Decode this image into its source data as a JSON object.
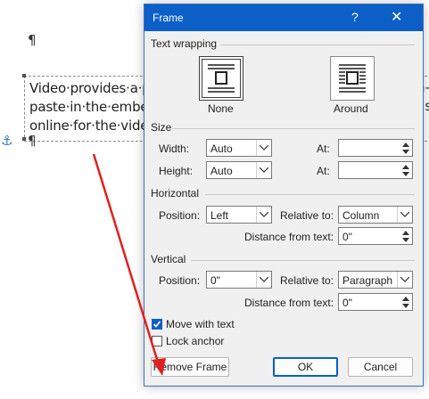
{
  "document": {
    "pilcrow": "¶",
    "anchor_icon": "anchor-icon",
    "lines": [
      "Video·provides·a·po",
      "paste·in·the·embed",
      "online·for·the·video"
    ],
    "right_fragments": [
      "n-",
      "als"
    ]
  },
  "dialog": {
    "title": "Frame",
    "help_glyph": "?",
    "close_glyph": "✕",
    "text_wrapping": {
      "heading": "Text wrapping",
      "options": [
        {
          "label": "None",
          "selected": true
        },
        {
          "label": "Around",
          "selected": false
        }
      ]
    },
    "size": {
      "heading": "Size",
      "width_label": "Width:",
      "width_value": "Auto",
      "height_label": "Height:",
      "height_value": "Auto",
      "at_label": "At:",
      "width_at_value": "",
      "height_at_value": ""
    },
    "horizontal": {
      "heading": "Horizontal",
      "position_label": "Position:",
      "position_value": "Left",
      "relative_label": "Relative to:",
      "relative_value": "Column",
      "distance_label": "Distance from text:",
      "distance_value": "0\""
    },
    "vertical": {
      "heading": "Vertical",
      "position_label": "Position:",
      "position_value": "0\"",
      "relative_label": "Relative to:",
      "relative_value": "Paragraph",
      "distance_label": "Distance from text:",
      "distance_value": "0\""
    },
    "move_with_text": {
      "label": "Move with text",
      "checked": true
    },
    "lock_anchor": {
      "label": "Lock anchor",
      "checked": false
    },
    "buttons": {
      "remove": "Remove Frame",
      "ok": "OK",
      "cancel": "Cancel"
    }
  },
  "colors": {
    "titlebar": "#0b5fc7",
    "arrow": "#e02020",
    "anchor": "#2a79c2"
  }
}
